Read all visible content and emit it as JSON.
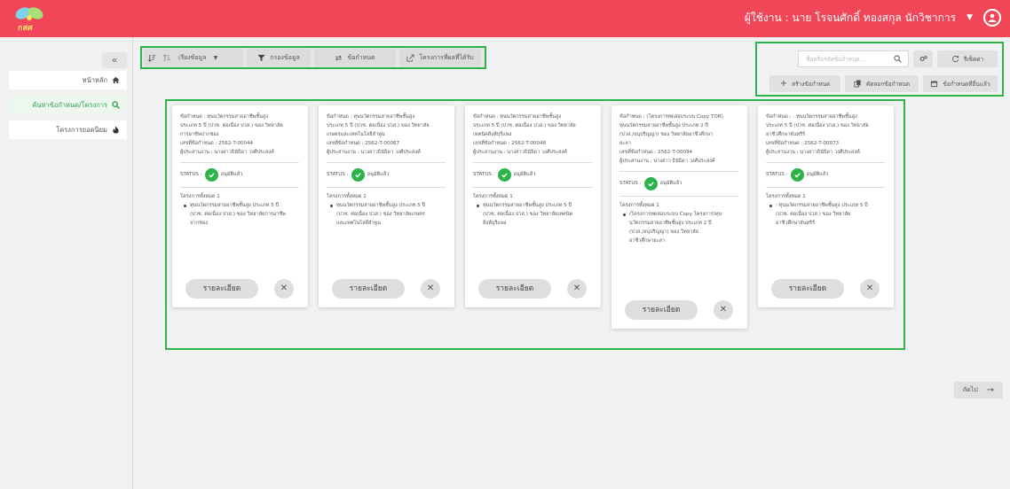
{
  "header": {
    "logo_text": "กสศ",
    "user_label": "ผู้ใช้งาน : นาย โรจนศักดิ์ ทองสกุล  นักวิชาการ",
    "colors": {
      "header_bg": "#f14658",
      "accent_green": "#2db34a"
    }
  },
  "sidebar": {
    "collapse_label": "«",
    "items": [
      {
        "label": "หน้าหลัก",
        "icon": "home-icon"
      },
      {
        "label": "ค้นหาข้อกำหนด/โครงการ",
        "icon": "search-icon"
      },
      {
        "label": "โครงการยอดนิยม",
        "icon": "fire-icon"
      }
    ]
  },
  "toolbar": {
    "sort_label": "เรียงข้อมูล",
    "filter_label": "กรองข้อมูล",
    "tor_label": "ข้อกำหนด",
    "related_label": "โครงการที่ผลที่ได้รับ"
  },
  "actions": {
    "search_placeholder": "ชื่อหรือรหัสข้อกำหนด...",
    "reset_label": "รีเซ็ตค่า",
    "create_label": "สร้างข้อกำหนด",
    "copy_label": "คัดลอกข้อกำหนด",
    "submitted_label": "ข้อกำหนดที่ยื่นแล้ว"
  },
  "cards": [
    {
      "title_lines": [
        "ข้อกำหนด : ทุนนวัตกรรมสายอาชีพชั้นสูง",
        "ประเภท 5 ปี (ปวช. ต่อเนื่อง ปวส.) ของ วิทยาลัย",
        "การอาชีพปากช่อง"
      ],
      "code": "เลขที่ข้อกำหนด : 2562-T-00044",
      "owner": "ผู้ประสานงาน : นางสาวธินัธิดา วงศ์ประสงค์",
      "status_label": "STATUS :",
      "status_value": "อนุมัติแล้ว",
      "project_header": "โครงการทั้งหมด 1",
      "project_lines": [
        "ทุนนวัตกรรมสายอาชีพชั้นสูง ประเภท 5 ปี",
        "(ปวช. ต่อเนื่อง ปวส.) ของ วิทยาลัยการอาชีพ",
        "ปากช่อง"
      ],
      "detail_label": "รายละเอียด"
    },
    {
      "title_lines": [
        "ข้อกำหนด : ทุนนวัตกรรมสายอาชีพชั้นสูง",
        "ประเภท 5 ปี (ปวช. ต่อเนื่อง ปวส.) ของ วิทยาลัย",
        "เกษตรและเทคโนโลยีลำพูน"
      ],
      "code": "เลขที่ข้อกำหนด : 2562-T-00067",
      "owner": "ผู้ประสานงาน : นางสาวธินัธิดา วงศ์ประสงค์",
      "status_label": "STATUS :",
      "status_value": "อนุมัติแล้ว",
      "project_header": "โครงการทั้งหมด 1",
      "project_lines": [
        "ทุนนวัตกรรมสายอาชีพชั้นสูง ประเภท 5 ปี",
        "(ปวช. ต่อเนื่อง ปวส.) ของ วิทยาลัยเกษตร",
        "และเทคโนโลยีลำพูน"
      ],
      "detail_label": "รายละเอียด"
    },
    {
      "title_lines": [
        "ข้อกำหนด : ทุนนวัตกรรมสายอาชีพชั้นสูง",
        "ประเภท 5 ปี (ปวช. ต่อเนื่อง ปวส.) ของ วิทยาลัย",
        "เทคนิคสิงห์บุรีแพง"
      ],
      "code": "เลขที่ข้อกำหนด : 2562-T-00048",
      "owner": "ผู้ประสานงาน : นางสาวธินัธิดา วงศ์ประสงค์",
      "status_label": "STATUS :",
      "status_value": "อนุมัติแล้ว",
      "project_header": "โครงการทั้งหมด 1",
      "project_lines": [
        "ทุนนวัตกรรมสายอาชีพชั้นสูง ประเภท 5 ปี",
        "(ปวช. ต่อเนื่อง ปวส.) ของ วิทยาลัยเทคนิค",
        "สิงห์บุรีแพง"
      ],
      "detail_label": "รายละเอียด"
    },
    {
      "title_lines": [
        "ข้อกำหนด : (โครงการทดสอบระบบ Copy TOR)",
        "ทุนนวัตกรรมสายอาชีพชั้นสูง ประเภท 2 ปี",
        "(ปวส./อนุปริญญา) ของ วิทยาลัยอาชีวศึกษา",
        "ยะลา"
      ],
      "code": "เลขที่ข้อกำหนด : 2562-T-00094",
      "owner": "ผู้ประสานงาน : นางสาว ธินัธิดา วงศ์ประสงค์",
      "status_label": "STATUS :",
      "status_value": "อนุมัติแล้ว",
      "project_header": "โครงการทั้งหมด 1",
      "project_lines": [
        "(โครงการทดสอบระบบ Copy โครงการ)ทุน",
        "นวัตกรรมสายอาชีพชั้นสูง ประเภท 2 ปี",
        "(ปวส./อนุปริญญา) ของ วิทยาลัย",
        "อาชีวศึกษายะลา"
      ],
      "detail_label": "รายละเอียด"
    },
    {
      "title_lines": [
        "ข้อกำหนด : : ทุนนวัตกรรมสายอาชีพชั้นสูง",
        "ประเภท 5 ปี (ปวช. ต่อเนื่อง ปวส.) ของ วิทยาลัย",
        "อาชีวศึกษาจันทรีร์"
      ],
      "code": "เลขที่ข้อกำหนด : 2562-T-00073",
      "owner": "ผู้ประสานงาน : นางสาวธินัธิดา วงศ์ประสงค์",
      "status_label": "STATUS :",
      "status_value": "อนุมัติแล้ว",
      "project_header": "โครงการทั้งหมด 1",
      "project_lines": [
        ": ทุนนวัตกรรมสายอาชีพชั้นสูง ประเภท 5 ปี",
        "(ปวช. ต่อเนื่อง ปวส.) ของ วิทยาลัย",
        "อาชีวศึกษาจันทรีร์"
      ],
      "detail_label": "รายละเอียด"
    }
  ],
  "pagination": {
    "next_label": "ถัดไป"
  }
}
